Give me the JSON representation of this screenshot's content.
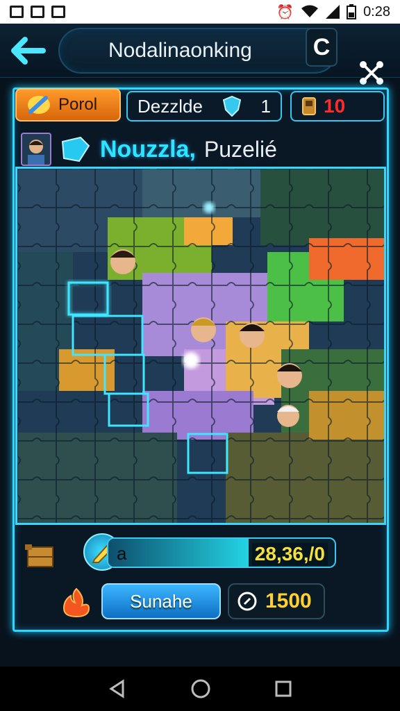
{
  "status_bar": {
    "time": "0:28"
  },
  "header": {
    "title": "Nodalinaonking",
    "menu_button_label": "C"
  },
  "info_bar": {
    "point_button_label": "Porol",
    "difficulty_label": "Dezzlde",
    "difficulty_value": "1",
    "timer_value": "10"
  },
  "puzzle": {
    "name_part1": "Nouzzla,",
    "name_part2": "Puzelié"
  },
  "progress": {
    "label": "a",
    "score": "28,36,/0",
    "fill_fraction": 0.62
  },
  "actions": {
    "main_button_label": "Sunahe",
    "coins": "1500"
  },
  "colors": {
    "accent": "#2fd6ff",
    "gold": "#f7df3d",
    "orange": "#ff9a2a",
    "timer_red": "#ff2b2b"
  },
  "icons": [
    "back-arrow-icon",
    "share-icon",
    "pencil-icon",
    "shield-icon",
    "timer-icon",
    "crate-icon",
    "fire-icon",
    "coin-icon",
    "wifi-icon",
    "battery-icon",
    "alarm-icon"
  ]
}
